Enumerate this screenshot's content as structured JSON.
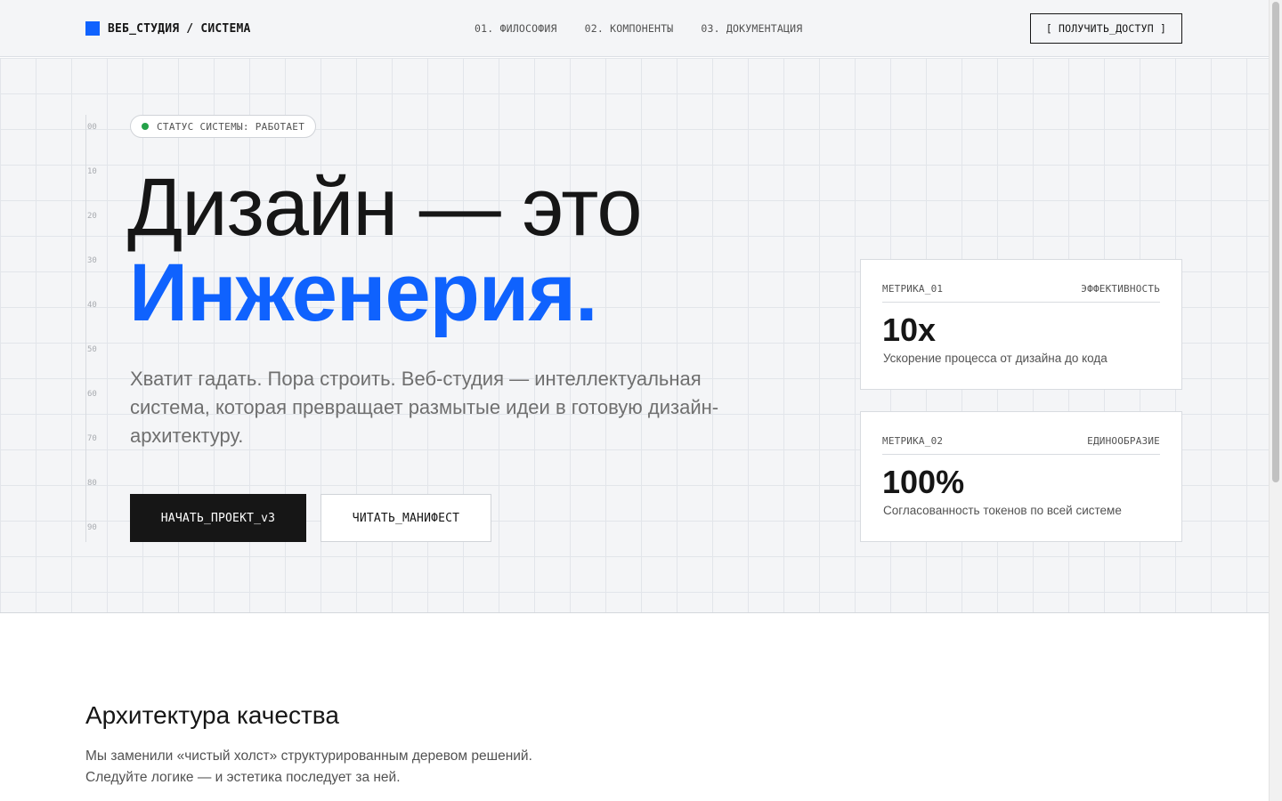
{
  "header": {
    "brand": "ВЕБ_СТУДИЯ / СИСТЕМА",
    "nav": [
      {
        "label": "01. ФИЛОСОФИЯ"
      },
      {
        "label": "02. КОМПОНЕНТЫ"
      },
      {
        "label": "03. ДОКУМЕНТАЦИЯ"
      }
    ],
    "cta": "[ ПОЛУЧИТЬ_ДОСТУП ]"
  },
  "hero": {
    "status": "СТАТУС СИСТЕМЫ: РАБОТАЕТ",
    "headline_line1": "Дизайн — это",
    "headline_line2": "Инженерия.",
    "lead": "Хватит гадать. Пора строить. Веб-студия — интеллектуальная система, которая превращает размытые идеи в готовую дизайн-архитектуру.",
    "primary_button": "НАЧАТЬ_ПРОЕКТ_v3",
    "secondary_button": "ЧИТАТЬ_МАНИФЕСТ",
    "ruler_ticks": [
      "00",
      "10",
      "20",
      "30",
      "40",
      "50",
      "60",
      "70",
      "80",
      "90"
    ]
  },
  "metrics": [
    {
      "id": "МЕТРИКА_01",
      "label": "ЭФФЕКТИВНОСТЬ",
      "value": "10x",
      "description": "Ускорение процесса от дизайна до кода"
    },
    {
      "id": "МЕТРИКА_02",
      "label": "ЕДИНООБРАЗИЕ",
      "value": "100%",
      "description": "Согласованность токенов по всей системе"
    }
  ],
  "section": {
    "title": "Архитектура качества",
    "text_line1": "Мы заменили «чистый холст» структурированным деревом решений.",
    "text_line2": "Следуйте логике — и эстетика последует за ней."
  },
  "colors": {
    "accent": "#0f62fe",
    "status_ok": "#24a148",
    "dark": "#161616"
  }
}
